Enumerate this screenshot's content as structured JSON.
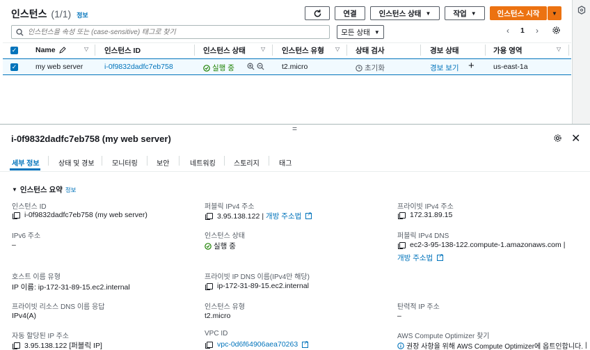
{
  "header": {
    "title": "인스턴스",
    "count": "(1/1)",
    "info": "정보",
    "connect_label": "연결",
    "state_label": "인스턴스 상태",
    "actions_label": "작업",
    "launch_label": "인스턴스 시작"
  },
  "search": {
    "placeholder": "인스턴스을 속성 또는 (case-sensitive) 태그로 찾기",
    "state_filter": "모든 상태"
  },
  "pagination": {
    "page": "1"
  },
  "table": {
    "columns": [
      "Name",
      "인스턴스 ID",
      "인스턴스 상태",
      "인스턴스 유형",
      "상태 검사",
      "경보 상태",
      "가용 영역"
    ],
    "row": {
      "name": "my web server",
      "id": "i-0f9832dadfc7eb758",
      "state": "실행 중",
      "type": "t2.micro",
      "check": "초기화",
      "alarm": "경보 보기",
      "az": "us-east-1a"
    }
  },
  "details": {
    "resizer": "=",
    "title": "i-0f9832dadfc7eb758 (my web server)",
    "tabs": [
      "세부 정보",
      "상태 및 경보",
      "모니터링",
      "보안",
      "네트워킹",
      "스토리지",
      "태그"
    ],
    "section_title": "인스턴스 요약",
    "section_info": "정보",
    "fields": {
      "instance_id_label": "인스턴스 ID",
      "instance_id": "i-0f9832dadfc7eb758 (my web server)",
      "public_ipv4_label": "퍼블릭 IPv4 주소",
      "public_ipv4": "3.95.138.122",
      "open_address": "개방 주소법",
      "private_ipv4_label": "프라이빗 IPv4 주소",
      "private_ipv4": "172.31.89.15",
      "ipv6_label": "IPv6 주소",
      "ipv6": "–",
      "state_label": "인스턴스 상태",
      "state": "실행 중",
      "public_dns_label": "퍼블릭 IPv4 DNS",
      "public_dns": "ec2-3-95-138-122.compute-1.amazonaws.com",
      "public_dns_open": "개방 주소법",
      "hostname_type_label": "호스트 이름 유형",
      "hostname_type": "IP 이름: ip-172-31-89-15.ec2.internal",
      "private_dns_label": "프라이빗 IP DNS 이름(IPv4만 해당)",
      "private_dns": "ip-172-31-89-15.ec2.internal",
      "resource_dns_label": "프라이빗 리소스 DNS 이름 응답",
      "resource_dns": "IPv4(A)",
      "type_label": "인스턴스 유형",
      "type": "t2.micro",
      "elastic_ip_label": "탄력적 IP 주소",
      "elastic_ip": "–",
      "auto_ip_label": "자동 할당된 IP 주소",
      "auto_ip": "3.95.138.122 [퍼블릭 IP]",
      "vpc_label": "VPC ID",
      "vpc": "vpc-0d6f64906aea70263",
      "optimizer_label": "AWS Compute Optimizer 찾기",
      "optimizer": "권장 사항을 위해 AWS Compute Optimizer에 옵트인합니다."
    }
  },
  "colors": {
    "accent": "#0073bb",
    "primary": "#ec7211",
    "success": "#1d8102"
  }
}
